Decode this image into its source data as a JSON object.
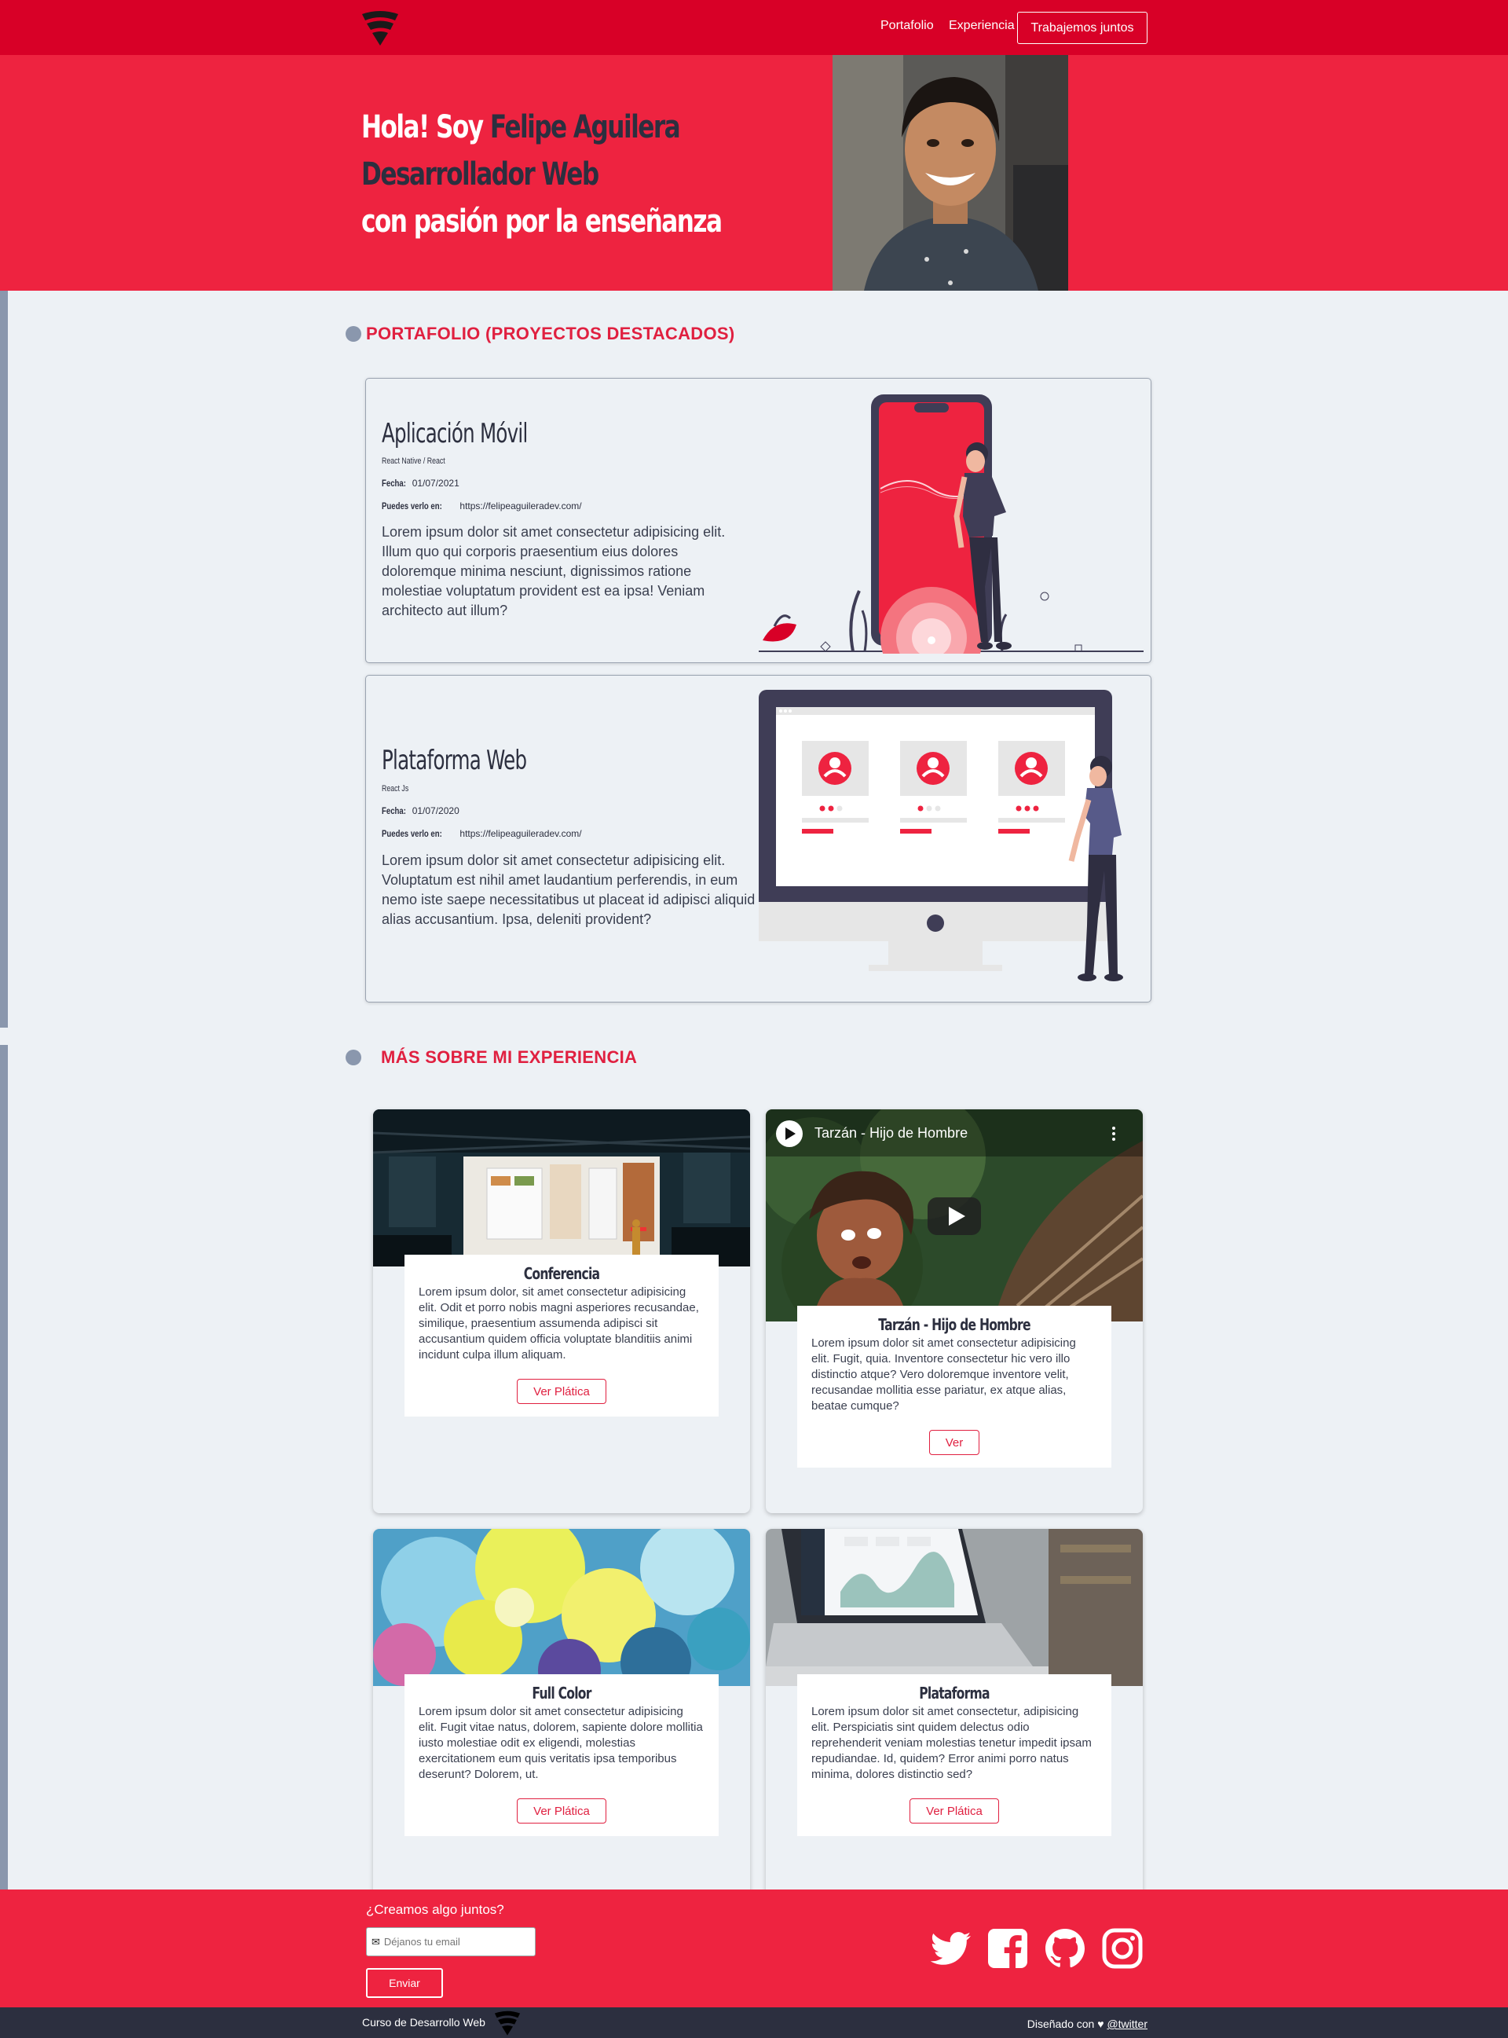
{
  "header": {
    "nav": [
      "Portafolio",
      "Experiencia"
    ],
    "cta": "Trabajemos juntos"
  },
  "hero": {
    "greeting": "Hola! Soy ",
    "name": "Felipe Aguilera",
    "role": "Desarrollador Web",
    "tagline": "con pasión por la enseñanza"
  },
  "portfolio": {
    "title": "PORTAFOLIO (PROYECTOS DESTACADOS)",
    "projects": [
      {
        "title": "Aplicación Móvil",
        "tech": "React Native / React",
        "date_label": "Fecha:",
        "date": "01/07/2021",
        "url_label": "Puedes verlo en:",
        "url": "https://felipeaguileradev.com/",
        "description": "Lorem ipsum dolor sit amet consectetur adipisicing elit. Illum quo qui corporis praesentium eius dolores doloremque minima nesciunt, dignissimos ratione molestiae voluptatum provident est ea ipsa! Veniam architecto aut illum?"
      },
      {
        "title": "Plataforma Web",
        "tech": "React Js",
        "date_label": "Fecha:",
        "date": "01/07/2020",
        "url_label": "Puedes verlo en:",
        "url": "https://felipeaguileradev.com/",
        "description": "Lorem ipsum dolor sit amet consectetur adipisicing elit. Voluptatum est nihil amet laudantium perferendis, in eum nemo iste saepe necessitatibus ut placeat id adipisci aliquid alias accusantium. Ipsa, deleniti provident?"
      }
    ]
  },
  "experience": {
    "title": "MÁS SOBRE MI EXPERIENCIA",
    "video_title": "Tarzán - Hijo de Hombre",
    "cards": [
      {
        "title": "Conferencia",
        "text": "Lorem ipsum dolor, sit amet consectetur adipisicing elit. Odit et porro nobis magni asperiores recusandae, similique, praesentium assumenda adipisci sit accusantium quidem officia voluptate blanditiis animi incidunt culpa illum aliquam.",
        "button": "Ver Plática"
      },
      {
        "title": "Tarzán - Hijo de Hombre",
        "text": "Lorem ipsum dolor sit amet consectetur adipisicing elit. Fugit, quia. Inventore consectetur hic vero illo distinctio atque? Vero doloremque inventore velit, recusandae mollitia esse pariatur, ex atque alias, beatae cumque?",
        "button": "Ver"
      },
      {
        "title": "Full Color",
        "text": "Lorem ipsum dolor sit amet consectetur adipisicing elit. Fugit vitae natus, dolorem, sapiente dolore mollitia iusto molestiae odit ex eligendi, molestias exercitationem eum quis veritatis ipsa temporibus deserunt? Dolorem, ut.",
        "button": "Ver Plática"
      },
      {
        "title": "Plataforma",
        "text": "Lorem ipsum dolor sit amet consectetur, adipisicing elit. Perspiciatis sint quidem delectus odio reprehenderit veniam molestias tenetur impedit ipsam repudiandae. Id, quidem? Error animi porro natus minima, dolores distinctio sed?",
        "button": "Ver Plática"
      }
    ]
  },
  "footer": {
    "question": "¿Creamos algo juntos?",
    "email_placeholder": "Déjanos tu email",
    "send": "Enviar",
    "socials": [
      "twitter-icon",
      "facebook-icon",
      "github-icon",
      "instagram-icon"
    ]
  },
  "bottom": {
    "course": "Curso de Desarrollo Web",
    "designed": "Diseñado con ",
    "twitter": "@twitter"
  },
  "colors": {
    "primary": "#ee2340",
    "header": "#d80027",
    "dark": "#2c2f3f",
    "background": "#edf1f5",
    "timeline": "#8a97ad"
  }
}
